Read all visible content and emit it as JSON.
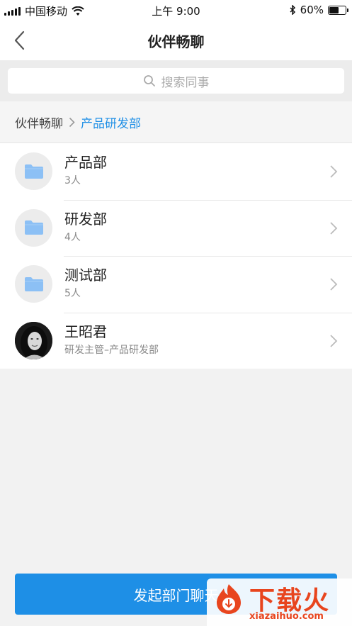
{
  "status_bar": {
    "carrier": "中国移动",
    "time": "上午 9:00",
    "battery": "60%",
    "battery_level": 0.6
  },
  "nav": {
    "title": "伙伴畅聊",
    "back_icon": "chevron-left-icon"
  },
  "search": {
    "placeholder": "搜索同事",
    "icon": "search-icon"
  },
  "breadcrumb": {
    "root": "伙伴畅聊",
    "current": "产品研发部"
  },
  "list": [
    {
      "type": "department",
      "title": "产品部",
      "subtitle": "3人",
      "icon": "folder-icon"
    },
    {
      "type": "department",
      "title": "研发部",
      "subtitle": "4人",
      "icon": "folder-icon"
    },
    {
      "type": "department",
      "title": "测试部",
      "subtitle": "5人",
      "icon": "folder-icon"
    },
    {
      "type": "person",
      "title": "王昭君",
      "subtitle": "研发主管–产品研发部",
      "icon": "avatar"
    }
  ],
  "bottom_button": {
    "label": "发起部门聊天"
  },
  "watermark": {
    "text": "下载火",
    "url": "xiazaihuo.com"
  },
  "colors": {
    "accent": "#1e8fe6",
    "folder": "#8cc0f5",
    "watermark": "#e8451e"
  }
}
